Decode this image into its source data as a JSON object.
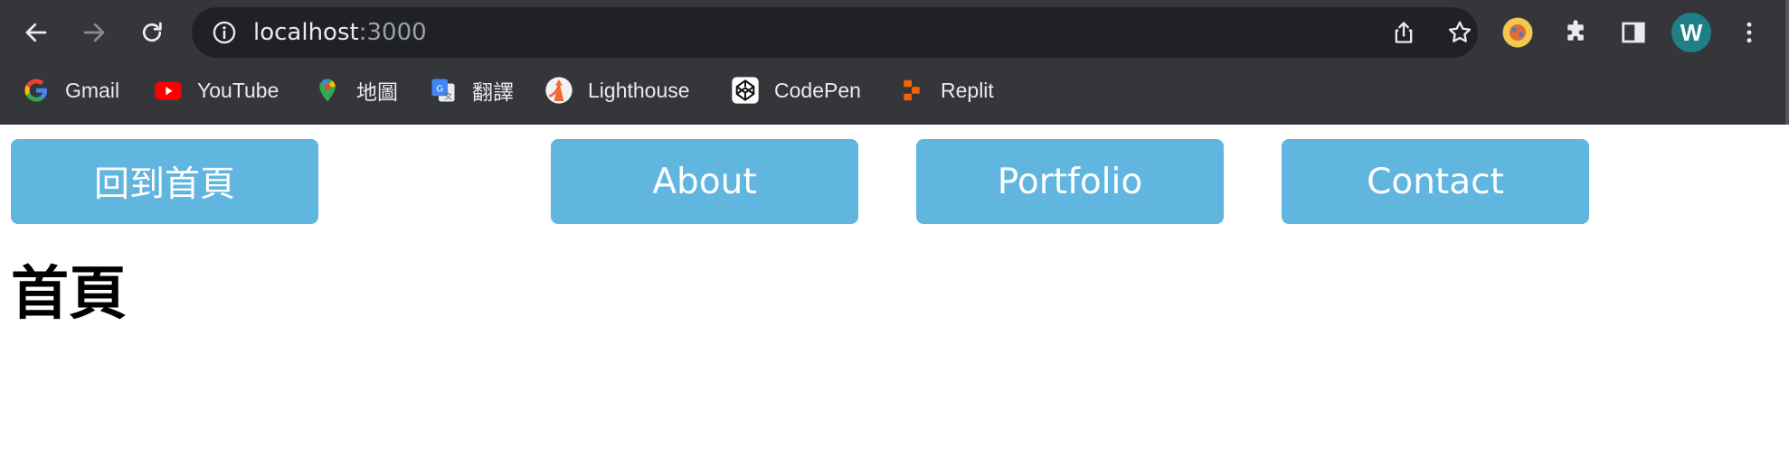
{
  "browser": {
    "url_host": "localhost",
    "url_port": ":3000",
    "profile_initial": "W",
    "toolbar_icons": [
      "back-arrow-icon",
      "forward-arrow-icon",
      "reload-icon",
      "site-info-icon",
      "share-icon",
      "bookmark-star-icon",
      "extension-icon",
      "puzzle-icon",
      "side-panel-icon",
      "kebab-menu-icon"
    ]
  },
  "bookmarks": [
    {
      "label": "Gmail",
      "icon": "google-icon"
    },
    {
      "label": "YouTube",
      "icon": "youtube-icon"
    },
    {
      "label": "地圖",
      "icon": "maps-pin-icon"
    },
    {
      "label": "翻譯",
      "icon": "translate-icon"
    },
    {
      "label": "Lighthouse",
      "icon": "lighthouse-icon"
    },
    {
      "label": "CodePen",
      "icon": "codepen-icon"
    },
    {
      "label": "Replit",
      "icon": "replit-icon"
    }
  ],
  "nav": {
    "home": "回到首頁",
    "about": "About",
    "portfolio": "Portfolio",
    "contact": "Contact"
  },
  "page": {
    "heading": "首頁"
  },
  "colors": {
    "chrome_bg": "#35363a",
    "omnibox_bg": "#202124",
    "button_bg": "#61b6e0",
    "button_text": "#ffffff",
    "avatar_bg": "#1e7f86"
  }
}
